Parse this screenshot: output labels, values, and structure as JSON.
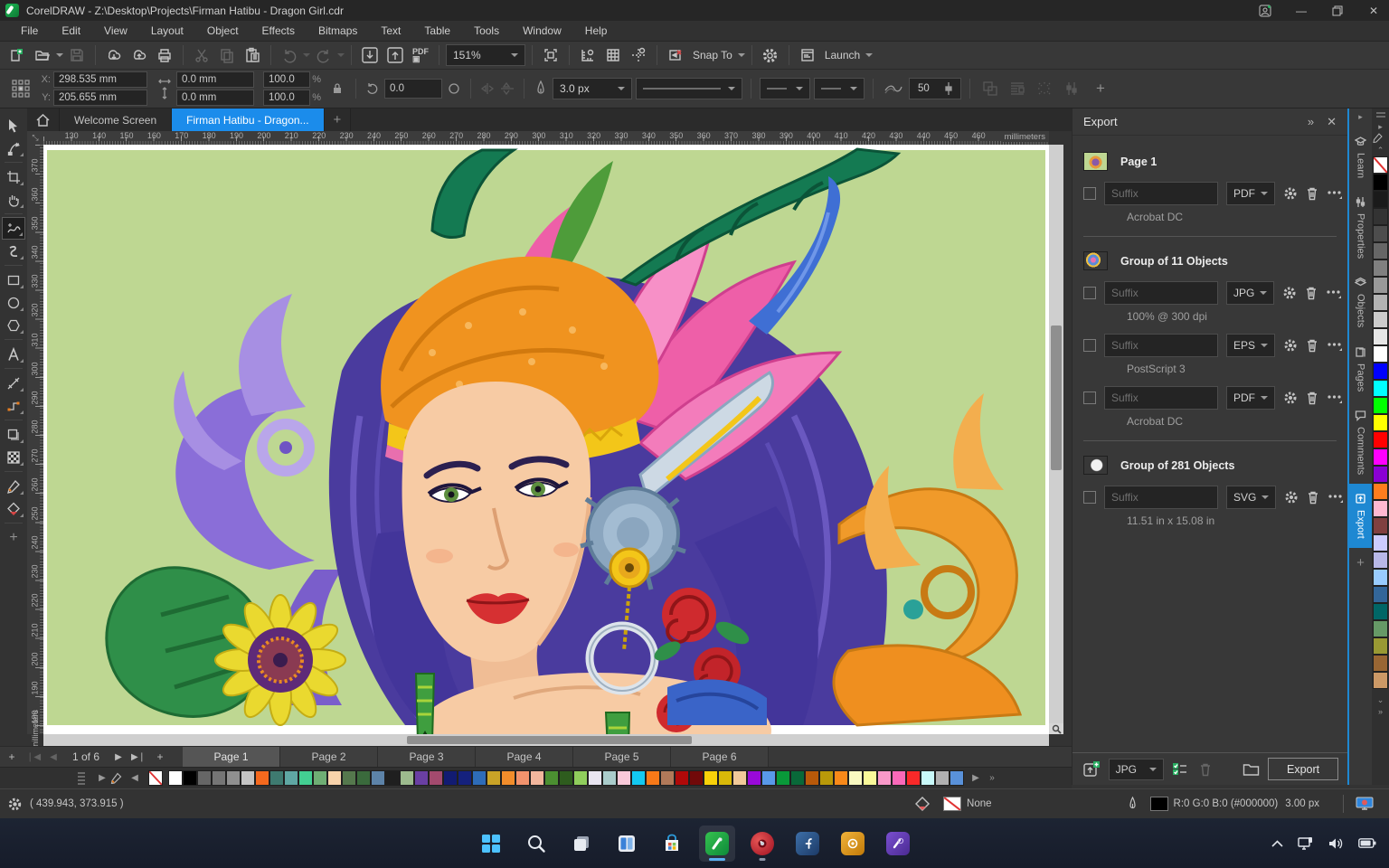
{
  "window": {
    "title": "CorelDRAW - Z:\\Desktop\\Projects\\Firman Hatibu - Dragon Girl.cdr"
  },
  "menu": {
    "items": [
      "File",
      "Edit",
      "View",
      "Layout",
      "Object",
      "Effects",
      "Bitmaps",
      "Text",
      "Table",
      "Tools",
      "Window",
      "Help"
    ]
  },
  "toolbar": {
    "zoom_value": "151%",
    "snap_label": "Snap To",
    "launch_label": "Launch",
    "pdf_label": "PDF"
  },
  "propbar": {
    "x_label": "X:",
    "y_label": "Y:",
    "x_value": "298.535 mm",
    "y_value": "205.655 mm",
    "w_value": "0.0 mm",
    "h_value": "0.0 mm",
    "scale_x": "100.0",
    "scale_y": "100.0",
    "pct_x": "%",
    "pct_y": "%",
    "angle_value": "0.0",
    "outline_width": "3.0 px",
    "smooth_value": "50"
  },
  "doc_tabs": {
    "welcome": "Welcome Screen",
    "active": "Firman Hatibu - Dragon..."
  },
  "ruler": {
    "h_ticks": [
      "130",
      "140",
      "150",
      "160",
      "170",
      "180",
      "190",
      "200",
      "210",
      "220",
      "230",
      "240",
      "250",
      "260",
      "270",
      "280",
      "290",
      "300",
      "310",
      "320",
      "330",
      "340",
      "350",
      "360",
      "370",
      "380",
      "390",
      "400",
      "410",
      "420",
      "430",
      "440",
      "450",
      "460"
    ],
    "v_ticks": [
      "370",
      "360",
      "350",
      "340",
      "330",
      "320",
      "310",
      "300",
      "290",
      "280",
      "270",
      "260",
      "250",
      "240",
      "230",
      "220",
      "210",
      "200",
      "190",
      "180"
    ],
    "unit_label": "millimeters"
  },
  "toolbox": {
    "tools": [
      "pick-tool",
      "shape-tool",
      "crop-tool",
      "pan-tool",
      "freehand-tool",
      "artistic-media-tool",
      "rectangle-tool",
      "ellipse-tool",
      "polygon-tool",
      "text-tool",
      "dimension-tool",
      "connector-tool",
      "drop-shadow-tool",
      "transparency-tool",
      "color-eyedropper-tool",
      "interactive-fill-tool",
      "add-tools-button"
    ]
  },
  "export_panel": {
    "title": "Export",
    "suffix_placeholder": "Suffix",
    "groups": [
      {
        "name": "Page 1",
        "rows": [
          {
            "format": "PDF",
            "detail": "Acrobat DC"
          }
        ]
      },
      {
        "name": "Group of 11 Objects",
        "rows": [
          {
            "format": "JPG",
            "detail": "100% @ 300 dpi"
          },
          {
            "format": "EPS",
            "detail": "PostScript 3"
          },
          {
            "format": "PDF",
            "detail": "Acrobat DC"
          }
        ]
      },
      {
        "name": "Group of 281 Objects",
        "rows": [
          {
            "format": "SVG",
            "detail": "11.51 in x 15.08 in"
          }
        ]
      }
    ],
    "footer": {
      "format": "JPG",
      "export_button": "Export"
    }
  },
  "dock": {
    "tabs": [
      "Learn",
      "Properties",
      "Objects",
      "Pages",
      "Comments",
      "Export"
    ],
    "active": "Export"
  },
  "page_nav": {
    "counter": "1 of 6",
    "pages": [
      "Page 1",
      "Page 2",
      "Page 3",
      "Page 4",
      "Page 5",
      "Page 6"
    ],
    "active_page": "Page 1"
  },
  "doc_palette": {
    "swatches": [
      "#ffffff",
      "#000000",
      "#666666",
      "#757575",
      "#8f8f8f",
      "#c4c4c4",
      "#f4691e",
      "#3e7a70",
      "#5fa7a3",
      "#43cf92",
      "#6fae74",
      "#f8d3ab",
      "#55784d",
      "#3a6a3c",
      "#5d83a8",
      "#1f1f1f",
      "#9dbb8e",
      "#6a3fa3",
      "#a34a6e",
      "#121b72",
      "#15217d",
      "#2e6cb8",
      "#c9a327",
      "#f28d2b",
      "#f2936d",
      "#f2b69d",
      "#4b8f31",
      "#2e5c1e",
      "#90ce5c",
      "#e9e5f1",
      "#aacccb",
      "#f9c9d9",
      "#13c9f1",
      "#f87918",
      "#b17959",
      "#b00909",
      "#710909",
      "#f9d109",
      "#d9b909",
      "#f1c999",
      "#9909d9",
      "#5999e9",
      "#099939",
      "#096939",
      "#b95909",
      "#b99909",
      "#f88919",
      "#f9f9c1",
      "#f9f999",
      "#f999c9",
      "#f969b9",
      "#f92929",
      "#c9f9f9",
      "#b1b1b1",
      "#5991d9"
    ]
  },
  "right_palette": {
    "swatches": [
      "#000000",
      "#1a1a1a",
      "#333333",
      "#4d4d4d",
      "#666666",
      "#808080",
      "#999999",
      "#b3b3b3",
      "#cccccc",
      "#e6e6e6",
      "#ffffff",
      "#0000ff",
      "#00ffff",
      "#00ff00",
      "#ffff00",
      "#ff0000",
      "#ff00ff",
      "#8a00d4",
      "#ff7d1e",
      "#ffb8d1",
      "#804040",
      "#ccccff",
      "#b8b8e8",
      "#99ccff",
      "#336699",
      "#006666",
      "#669966",
      "#999933",
      "#996633",
      "#cc9966"
    ]
  },
  "status": {
    "coords": "( 439.943, 373.915 )",
    "fill_label": "None",
    "outline_color": "R:0 G:0 B:0 (#000000)",
    "outline_width": "3.00 px"
  },
  "taskbar": {
    "apps": [
      "start",
      "search",
      "task-view",
      "widgets",
      "store",
      "coreldraw",
      "photo-paint",
      "font-manager",
      "capture",
      "corel-vector"
    ]
  },
  "colors": {
    "accent": "#1e88d2",
    "canvas_bg": "#bed792"
  }
}
